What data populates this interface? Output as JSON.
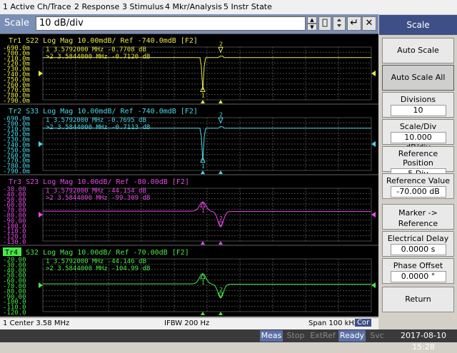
{
  "menu": [
    "1 Active Ch/Trace",
    "2 Response",
    "3 Stimulus",
    "4 Mkr/Analysis",
    "5 Instr State"
  ],
  "entry": {
    "label": "Scale",
    "value": "10 dB/div",
    "buttons": [
      "▲",
      "▼",
      "↵",
      "✕"
    ]
  },
  "softkeys": {
    "title": "Scale",
    "items": [
      {
        "label": "Auto Scale",
        "value": ""
      },
      {
        "label": "Auto Scale All",
        "value": ""
      },
      {
        "label": "Divisions",
        "value": "10"
      },
      {
        "label": "Scale/Div",
        "value": "10.000 dB/div"
      },
      {
        "label": "Reference Position",
        "value": "5 Div"
      },
      {
        "label": "Reference Value",
        "value": "-70.000 dB"
      },
      {
        "label": "Marker -> Reference",
        "value": ""
      },
      {
        "label": "Electrical Delay",
        "value": "0.0000 s"
      },
      {
        "label": "Phase Offset",
        "value": "0.0000 °"
      },
      {
        "label": "Return",
        "value": ""
      }
    ]
  },
  "status": {
    "center": "1  Center 3.58 MHz",
    "ifbw": "IFBW 200 Hz",
    "span": "Span 100 kHz",
    "cor": "Cor"
  },
  "bottom": {
    "meas": "Meas",
    "stop": "Stop",
    "extref": "ExtRef",
    "ready": "Ready",
    "svc": "Svc",
    "datetime": "2017-08-10 15:28"
  },
  "colors": {
    "s22": "#e8e84a",
    "s33": "#4ad8e8",
    "s23": "#e84ae8",
    "s32": "#4ae84a",
    "menu_highlight": "#3e4f87"
  },
  "traces": [
    {
      "header": "Tr1  S22  Log Mag  10.00mdB/  Ref  -740.0mdB  [F2]",
      "ticks": [
        "-690.0m",
        "-700.0m",
        "-710.0m",
        "-720.0m",
        "-730.0m",
        "-740.0m",
        "-750.0m",
        "-760.0m",
        "-770.0m",
        "-780.0m",
        "-790.0m"
      ],
      "markers": [
        "1   3.5792000  MHz  -0.7708  dB",
        ">2   3.5844000  MHz  -0.7120  dB"
      ],
      "marker_ids": [
        "1",
        "2"
      ],
      "color": "#e8e84a"
    },
    {
      "header": "Tr2  S33  Log Mag  10.00mdB/  Ref  -740.0mdB  [F2]",
      "ticks": [
        "-690.0m",
        "-700.0m",
        "-710.0m",
        "-720.0m",
        "-730.0m",
        "-740.0m",
        "-750.0m",
        "-760.0m",
        "-770.0m",
        "-780.0m",
        "-790.0m"
      ],
      "markers": [
        "1   3.5792000  MHz  -0.7695  dB",
        ">2   3.5844000  MHz  -0.7113  dB"
      ],
      "marker_ids": [
        "1",
        "2"
      ],
      "color": "#4ad8e8"
    },
    {
      "header": "Tr3  S23  Log Mag  10.00dB/  Ref  -80.00dB  [F2]",
      "ticks": [
        "-30.00",
        "-40.00",
        "-50.00",
        "-60.00",
        "-70.00",
        "-80.00",
        "-90.00",
        "-100.0",
        "-110.0",
        "-120.0",
        "-130.0"
      ],
      "markers": [
        "1   3.5792000  MHz  -44.154  dB",
        ">2   3.5844000  MHz  -99.309  dB"
      ],
      "marker_ids": [
        "1",
        "2"
      ],
      "color": "#e84ae8"
    },
    {
      "tag": "Tr4",
      "header": "S32  Log Mag  10.00dB/  Ref  -70.00dB  [F2]",
      "ticks": [
        "-20.00",
        "-30.00",
        "-40.00",
        "-50.00",
        "-60.00",
        "-70.00",
        "-80.00",
        "-90.00",
        "-100.0",
        "-110.0",
        "-120.0"
      ],
      "markers": [
        "1   3.5792000  MHz  -44.146  dB",
        ">2   3.5844000  MHz  -104.99  dB"
      ],
      "marker_ids": [
        "1",
        "2"
      ],
      "color": "#4ae84a"
    }
  ]
}
